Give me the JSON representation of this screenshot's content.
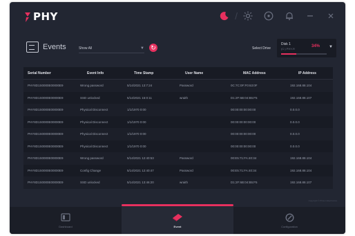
{
  "app": {
    "brand": "PHY"
  },
  "colors": {
    "accent": "#e7305e",
    "background": "#222632",
    "panel": "#181b24"
  },
  "header": {
    "icons": [
      "moon-icon",
      "sun-icon",
      "info-icon",
      "bell-icon",
      "minimize-icon",
      "close-icon"
    ],
    "separator": "/"
  },
  "toolbar": {
    "events_label": "Events",
    "show_select_value": "Show All",
    "select_drive_label": "Select Drive",
    "drive": {
      "name": "Disk 1",
      "subtitle": "(C:) PHY-R",
      "percent": "34%",
      "usage_fraction": 0.34
    }
  },
  "table": {
    "headers": [
      "Serial Number",
      "Event Info",
      "Time Stamp",
      "User Name",
      "MAC Address",
      "IP Address"
    ],
    "rows": [
      [
        "PHY8D1S0000E00000E9",
        "Wrong password",
        "5/14/2021 13:7:24",
        "Password",
        "0C:7C:0F:F0:63:0F",
        "192.168.88.104"
      ],
      [
        "PHY8D1S0000E00000E9",
        "SSD unlocked",
        "5/14/2021 15:0:11",
        "wraith",
        "D1:2F:6B:04:B5:F5",
        "192.168.88.107"
      ],
      [
        "PHY8D1S0000E00000E9",
        "Physical Disconnect",
        "1/1/1970 0:00",
        "",
        "00:00:00:00:00:00",
        "0.0.0.0"
      ],
      [
        "PHY8D1S0000E00000E9",
        "Physical Disconnect",
        "1/1/1970 0:00",
        "",
        "00:00:00:00:00:00",
        "0.0.0.0"
      ],
      [
        "PHY8D1S0000E00000E9",
        "Physical Disconnect",
        "1/1/1970 0:00",
        "",
        "00:00:00:00:00:00",
        "0.0.0.0"
      ],
      [
        "PHY8D1S0000E00000E9",
        "Physical Disconnect",
        "1/1/1970 0:00",
        "",
        "00:00:00:00:00:00",
        "0.0.0.0"
      ],
      [
        "PHY8D1S0000E00000E9",
        "Wrong password",
        "5/14/2021 12:40:53",
        "Password",
        "00:E5:71:FA:40:34",
        "192.168.88.104"
      ],
      [
        "PHY8D1S0000E00000E9",
        "Config Change",
        "5/14/2021 12:40:47",
        "Password",
        "00:E5:71:FA:40:34",
        "192.168.88.104"
      ],
      [
        "PHY8D1S0000E00000E9",
        "SSD unlocked",
        "5/14/2021 13:46:20",
        "wraith",
        "D1:2F:6B:04:B5:F5",
        "192.168.88.107"
      ]
    ]
  },
  "footer": {
    "copyright": "Copyright © Phison Electronics"
  },
  "nav": {
    "items": [
      {
        "label": "Dashboard",
        "icon": "dashboard-icon",
        "active": false
      },
      {
        "label": "Event",
        "icon": "event-icon",
        "active": true
      },
      {
        "label": "Configuration",
        "icon": "gear-icon",
        "active": false
      }
    ]
  }
}
